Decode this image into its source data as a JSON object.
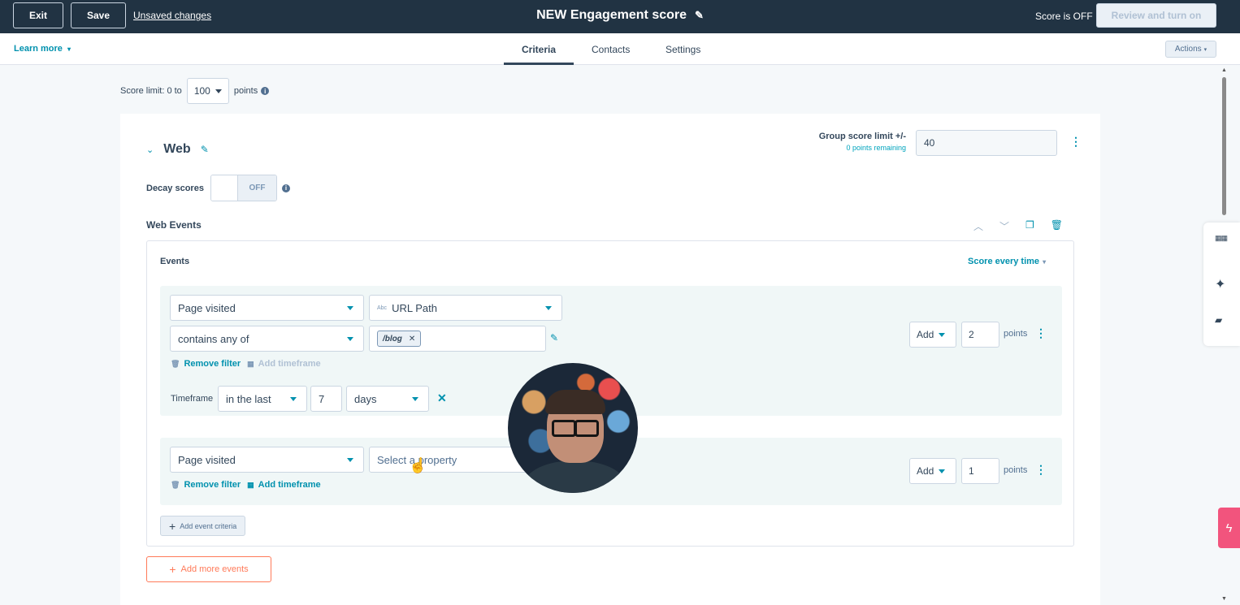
{
  "topbar": {
    "exit_label": "Exit",
    "save_label": "Save",
    "unsaved_label": "Unsaved changes",
    "title": "NEW Engagement score",
    "score_status": "Score is OFF",
    "review_label": "Review and turn on"
  },
  "subnav": {
    "learn_more": "Learn more",
    "tabs": [
      {
        "label": "Criteria",
        "active": true
      },
      {
        "label": "Contacts",
        "active": false
      },
      {
        "label": "Settings",
        "active": false
      }
    ],
    "actions_label": "Actions"
  },
  "score_limit": {
    "prefix": "Score limit: 0 to",
    "value": "100",
    "suffix": "points"
  },
  "group": {
    "name": "Web",
    "limit_label": "Group score limit +/-",
    "remaining": "0 points remaining",
    "limit_value": "40",
    "decay_label": "Decay scores",
    "decay_state": "OFF",
    "events_section_title": "Web Events"
  },
  "events": {
    "label": "Events",
    "score_mode": "Score every time",
    "filters": [
      {
        "event": "Page visited",
        "property": "URL Path",
        "property_type": "Abc",
        "operator": "contains any of",
        "chip_value": "/blog",
        "remove_label": "Remove filter",
        "timeframe_link": "Add timeframe",
        "timeframe_label": "Timeframe",
        "timeframe_op": "in the last",
        "timeframe_value": "7",
        "timeframe_unit": "days",
        "action": "Add",
        "points": "2",
        "points_label": "points"
      },
      {
        "event": "Page visited",
        "property_placeholder": "Select a property",
        "remove_label": "Remove filter",
        "timeframe_link": "Add timeframe",
        "action": "Add",
        "points": "1",
        "points_label": "points"
      }
    ],
    "add_criteria_label": "Add event criteria"
  },
  "add_more_events_label": "Add more events",
  "colors": {
    "topbar": "#213343",
    "accent": "#0091ae",
    "orange": "#ff7a59",
    "bolt": "#f2547d"
  }
}
